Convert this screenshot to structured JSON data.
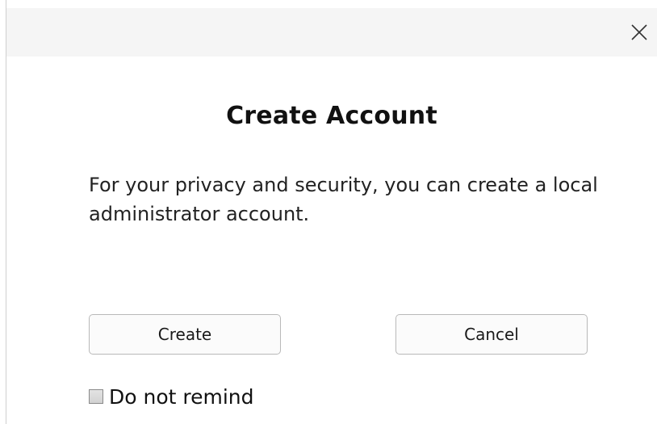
{
  "dialog": {
    "close_icon": "close-icon",
    "title": "Create Account",
    "message": "For your privacy and security, you can create a local administrator account.",
    "buttons": {
      "create_label": "Create",
      "cancel_label": "Cancel"
    },
    "remind": {
      "label": "Do not remind",
      "checked": false
    }
  }
}
